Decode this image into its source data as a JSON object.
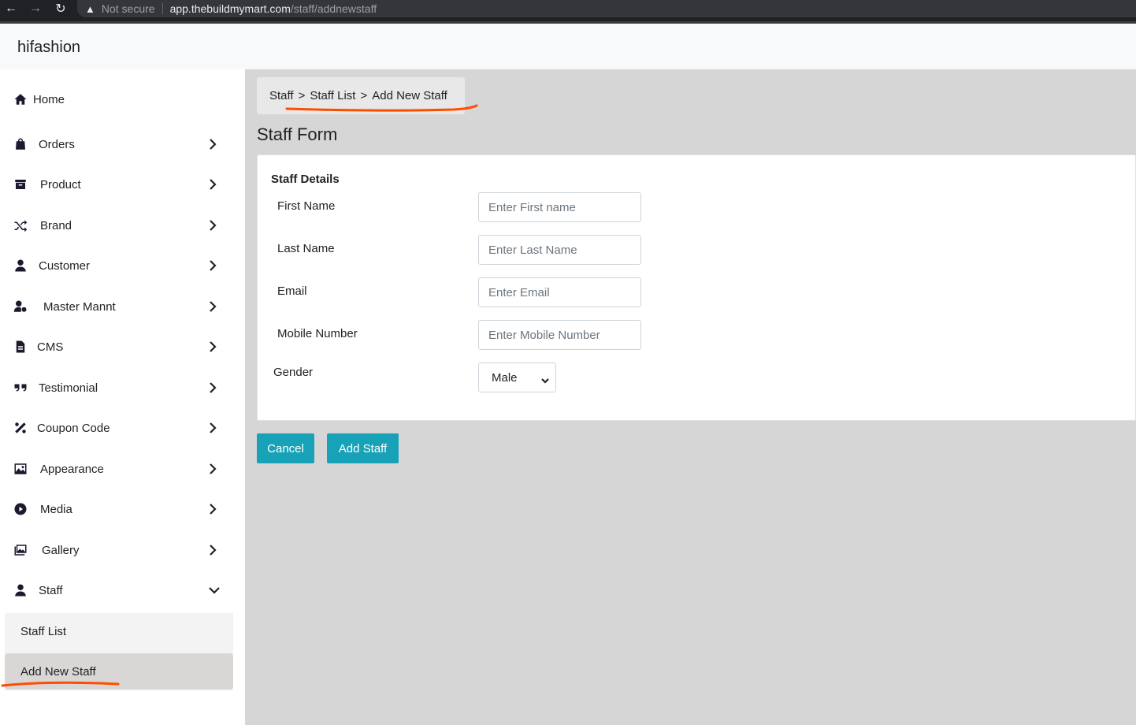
{
  "browser": {
    "not_secure": "Not secure",
    "url_host": "app.thebuildmymart.com",
    "url_path": "/staff/addnewstaff"
  },
  "app": {
    "brand": "hifashion"
  },
  "sidebar": {
    "items": [
      {
        "label": "Home",
        "icon": "home-icon"
      },
      {
        "label": "Orders",
        "icon": "shopping-bag-icon"
      },
      {
        "label": "Product",
        "icon": "archive-box-icon"
      },
      {
        "label": "Brand",
        "icon": "shuffle-icon"
      },
      {
        "label": "Customer",
        "icon": "user-icon"
      },
      {
        "label": "Master Mannt",
        "icon": "user-gear-icon"
      },
      {
        "label": "CMS",
        "icon": "file-icon"
      },
      {
        "label": "Testimonial",
        "icon": "quote-icon"
      },
      {
        "label": "Coupon Code",
        "icon": "percent-icon"
      },
      {
        "label": "Appearance",
        "icon": "image-icon"
      },
      {
        "label": "Media",
        "icon": "play-circle-icon"
      },
      {
        "label": "Gallery",
        "icon": "images-icon"
      },
      {
        "label": "Staff",
        "icon": "user-icon"
      }
    ],
    "staff_sub": [
      {
        "label": "Staff List"
      },
      {
        "label": "Add New Staff"
      }
    ]
  },
  "breadcrumb": {
    "part1": "Staff",
    "part2": "Staff List",
    "part3": "Add New Staff",
    "separator": ">"
  },
  "form": {
    "title": "Staff Form",
    "section_title": "Staff Details",
    "first_name_label": "First Name",
    "first_name_placeholder": "Enter First name",
    "last_name_label": "Last Name",
    "last_name_placeholder": "Enter Last Name",
    "email_label": "Email",
    "email_placeholder": "Enter Email",
    "mobile_label": "Mobile Number",
    "mobile_placeholder": "Enter Mobile Number",
    "gender_label": "Gender",
    "gender_value": "Male"
  },
  "actions": {
    "cancel": "Cancel",
    "add": "Add Staff"
  },
  "colors": {
    "accent": "#17a2b8",
    "annotation": "#ff4d00",
    "main_bg": "#d6d6d6"
  }
}
